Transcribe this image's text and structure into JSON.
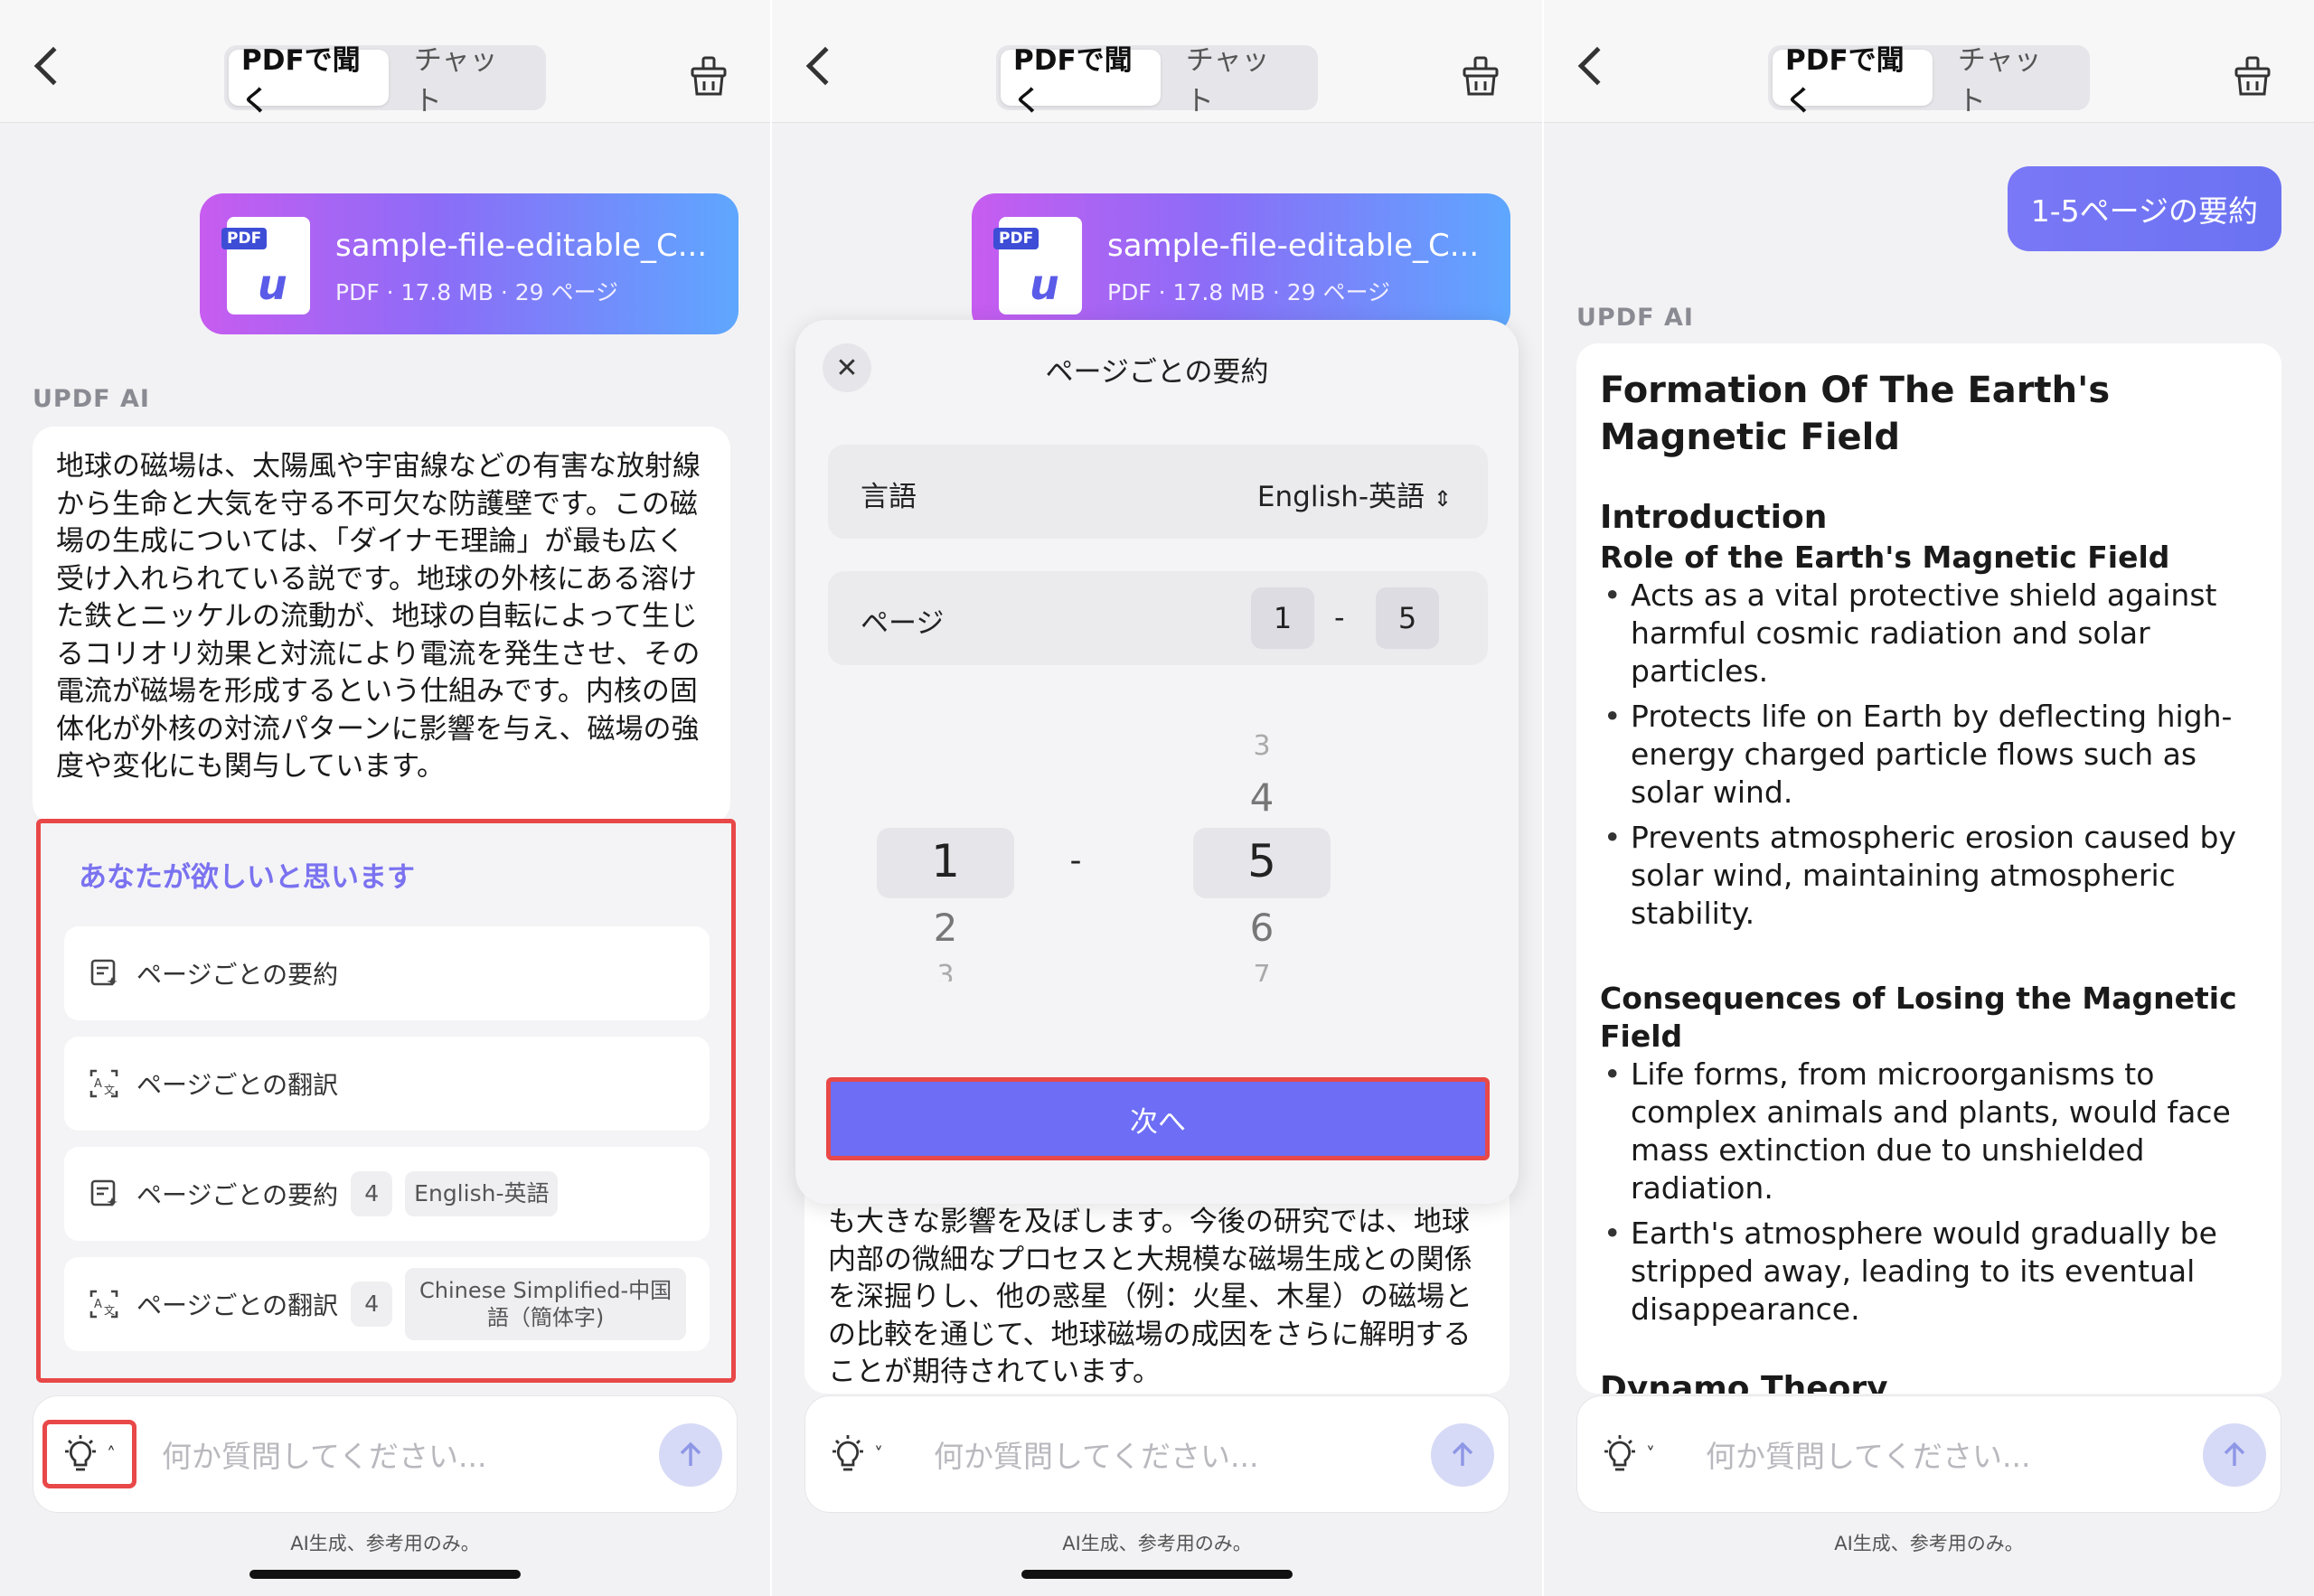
{
  "header": {
    "tab_active": "PDFで聞く",
    "tab_inactive": "チャット"
  },
  "file": {
    "name": "sample-file-editable_C...",
    "meta": "PDF · 17.8 MB · 29 ページ",
    "tag": "PDF"
  },
  "ai_label": "UPDF AI",
  "panel1": {
    "answer": "地球の磁場は、太陽風や宇宙線などの有害な放射線から生命と大気を守る不可欠な防護壁です。この磁場の生成については、「ダイナモ理論」が最も広く受け入れられている説です。地球の外核にある溶けた鉄とニッケルの流動が、地球の自転によって生じるコリオリ効果と対流により電流を発生させ、その電流が磁場を形成するという仕組みです。内核の固体化が外核の対流パターンに影響を与え、磁場の強度や変化にも関与しています。",
    "suggestions_title": "あなたが欲しいと思います",
    "suggestions": [
      {
        "label": "ページごとの要約",
        "icon": "summary-icon"
      },
      {
        "label": "ページごとの翻訳",
        "icon": "translate-icon"
      },
      {
        "label": "ページごとの要約",
        "icon": "summary-icon",
        "count": "4",
        "lang": "English-英語"
      },
      {
        "label": "ページごとの翻訳",
        "icon": "translate-icon",
        "count": "4",
        "lang": "Chinese Simplified-中国語（簡体字)"
      }
    ]
  },
  "panel2": {
    "modal_title": "ページごとの要約",
    "language_label": "言語",
    "language_value": "English-英語",
    "page_label": "ページ",
    "page_from": "1",
    "page_dash": "-",
    "page_to": "5",
    "picker_left": [
      "1",
      "2",
      "3"
    ],
    "picker_right": [
      "3",
      "4",
      "5",
      "6",
      "7"
    ],
    "next_button": "次へ",
    "under_text": "も大きな影響を及ぼします。今後の研究では、地球内部の微細なプロセスと大規模な磁場生成との関係を深掘りし、他の惑星（例：火星、木星）の磁場との比較を通じて、地球磁場の成因をさらに解明することが期待されています。"
  },
  "panel3": {
    "user_message": "1-5ページの要約",
    "doc": {
      "title": "Formation Of The Earth's Magnetic Field",
      "intro_heading": "Introduction",
      "role_heading": "Role of the Earth's Magnetic Field",
      "role_points": [
        "Acts as a vital protective shield against harmful cosmic radiation and solar particles.",
        "Protects life on Earth by deflecting high-energy charged particle flows such as solar wind.",
        "Prevents atmospheric erosion caused by solar wind, maintaining atmospheric stability."
      ],
      "consequences_heading": "Consequences of Losing the Magnetic Field",
      "consequences_points": [
        "Life forms, from microorganisms to complex animals and plants, would face mass extinction due to unshielded radiation.",
        "Earth's atmosphere would gradually be stripped away, leading to its eventual disappearance."
      ],
      "next_heading": "Dynamo Theory"
    }
  },
  "input": {
    "placeholder": "何か質問してください...",
    "footnote": "AI生成、参考用のみ。"
  },
  "colors": {
    "accent": "#6d6ef5",
    "highlight": "#e84848",
    "label_purple": "#7a72f0"
  }
}
